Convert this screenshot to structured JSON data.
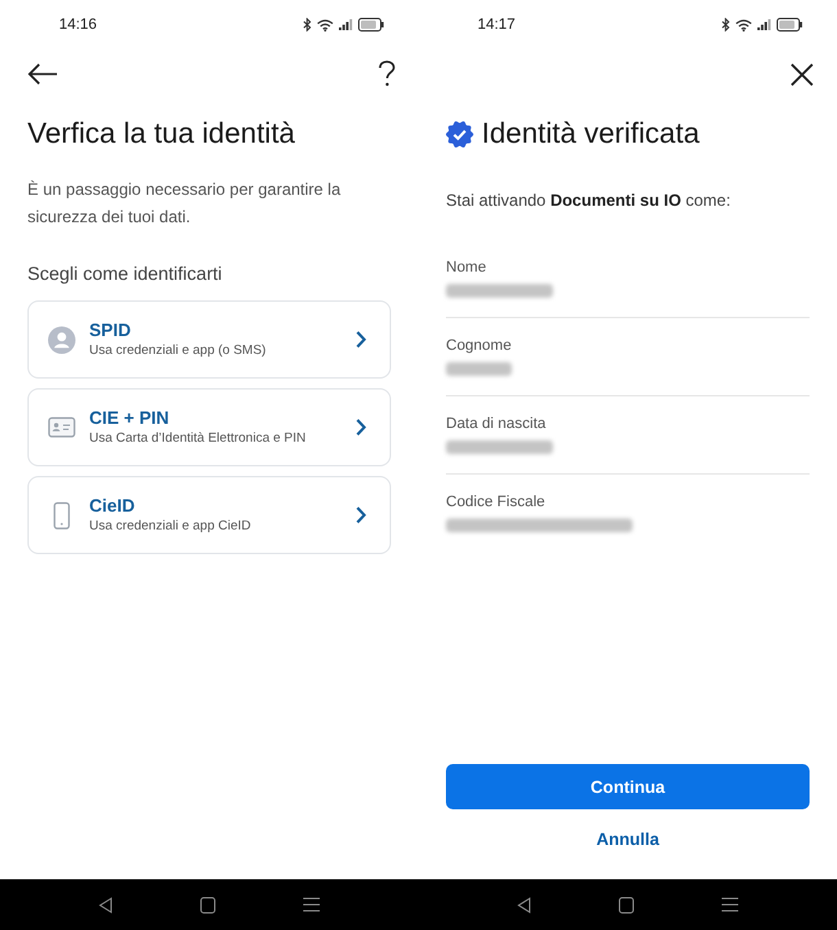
{
  "screens": [
    {
      "kind": "choice",
      "status_bar": {
        "time": "14:16"
      },
      "title": "Verfica la tua identità",
      "description": "È un passaggio necessario per garantire la sicurezza dei tuoi dati.",
      "section_label": "Scegli come identificarti",
      "options": [
        {
          "title": "SPID",
          "subtitle": "Usa credenziali e app (o SMS)"
        },
        {
          "title": "CIE + PIN",
          "subtitle": "Usa Carta d’Identità Elettronica e PIN"
        },
        {
          "title": "CieID",
          "subtitle": "Usa credenziali e app CieID"
        }
      ]
    },
    {
      "kind": "summary",
      "status_bar": {
        "time": "14:17"
      },
      "title": "Identità verificata",
      "verified": true,
      "intro": "Stai attivando **Documenti su IO** come:",
      "fields": [
        {
          "label": "Nome",
          "value_hidden": true
        },
        {
          "label": "Cognome",
          "value_hidden": true
        },
        {
          "label": "Data di nascita",
          "value_hidden": true
        },
        {
          "label": "Codice Fiscale",
          "value_hidden": true
        }
      ],
      "primary_button": "Continua",
      "secondary_button": "Annulla"
    }
  ]
}
